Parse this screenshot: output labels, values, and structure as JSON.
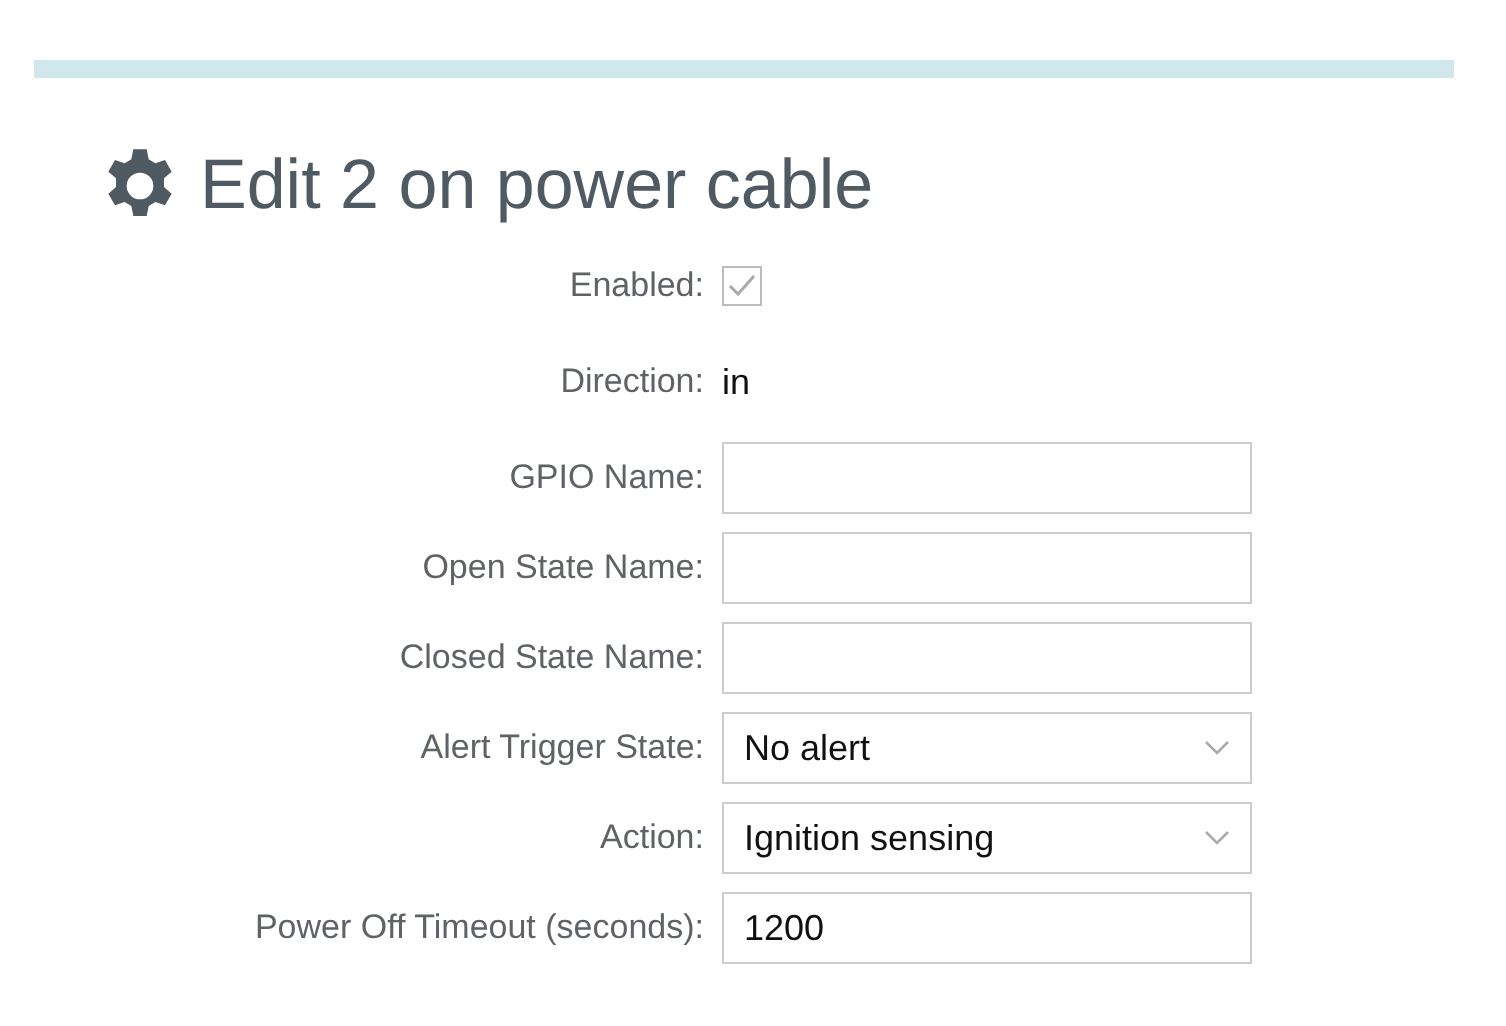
{
  "title": "Edit 2 on power cable",
  "fields": [
    {
      "kind": "checkbox",
      "label": "Enabled:",
      "checked": true,
      "disabled": true
    },
    {
      "kind": "static",
      "label": "Direction:",
      "value": "in"
    },
    {
      "kind": "text",
      "label": "GPIO Name:"
    },
    {
      "kind": "text",
      "label": "Open State Name:"
    },
    {
      "kind": "text",
      "label": "Closed State Name:"
    },
    {
      "kind": "select",
      "label": "Alert Trigger State:",
      "value": "No alert"
    },
    {
      "kind": "select",
      "label": "Action:",
      "value": "Ignition sensing"
    },
    {
      "kind": "text",
      "label": "Power Off Timeout (seconds):",
      "value": "1200"
    }
  ]
}
